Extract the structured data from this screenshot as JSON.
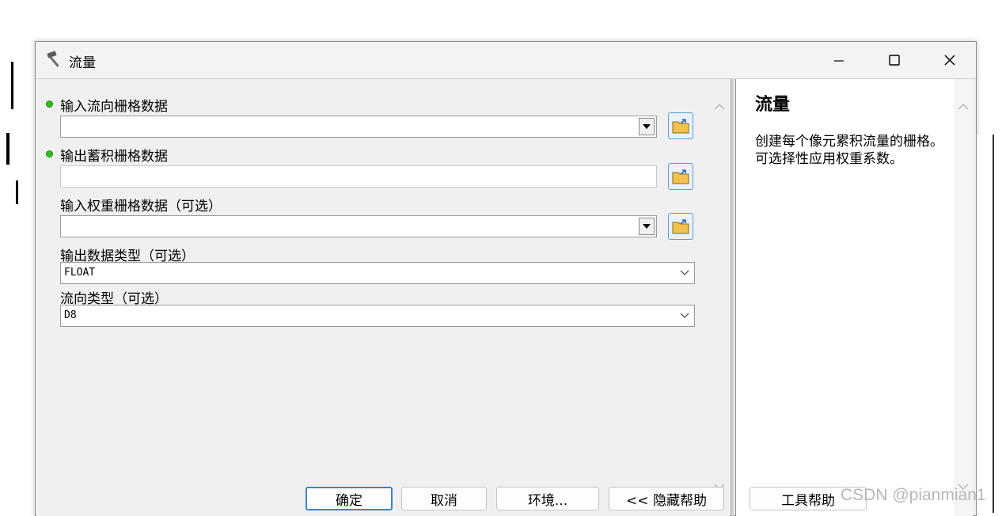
{
  "window": {
    "title": "流量",
    "controls": [
      "minimize-icon",
      "maximize-icon",
      "close-icon"
    ]
  },
  "params": {
    "in_flow_direction": {
      "label": "输入流向栅格数据",
      "required": true,
      "value": "",
      "control": "combobox"
    },
    "out_accumulation": {
      "label": "输出蓄积栅格数据",
      "required": true,
      "value": "",
      "control": "textbox"
    },
    "in_weight": {
      "label": "输入权重栅格数据（可选）",
      "required": false,
      "value": "",
      "control": "combobox"
    },
    "data_type": {
      "label": "输出数据类型（可选）",
      "value": "FLOAT",
      "control": "dropdown"
    },
    "flow_type": {
      "label": "流向类型（可选）",
      "value": "D8",
      "control": "dropdown"
    }
  },
  "help": {
    "title": "流量",
    "body": "创建每个像元累积流量的栅格。可选择性应用权重系数。"
  },
  "buttons": {
    "ok": "确定",
    "cancel": "取消",
    "environments": "环境...",
    "hide_help": "<< 隐藏帮助",
    "tool_help": "工具帮助"
  },
  "watermark": "CSDN @pianmian1",
  "colors": {
    "required_dot": "#2fbf1f",
    "default_button_border": "#3a85d0",
    "browse_button_border": "#5b9bd5"
  }
}
